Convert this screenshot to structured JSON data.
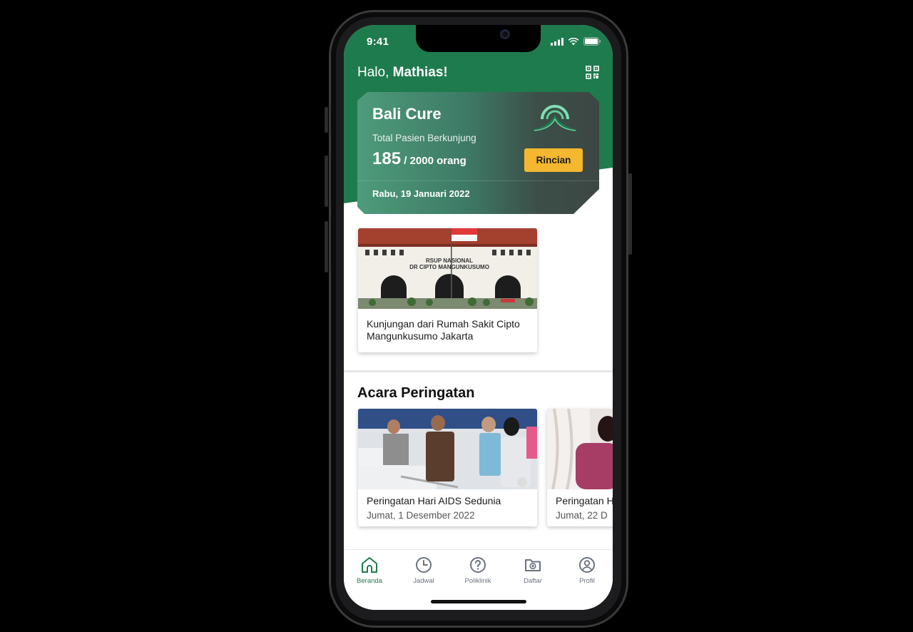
{
  "status_bar": {
    "time": "9:41"
  },
  "header": {
    "greeting_prefix": "Halo, ",
    "user_name": "Mathias!",
    "qr_icon": "qr-code-icon"
  },
  "hero_card": {
    "title": "Bali Cure",
    "subtitle": "Total Pasien Berkunjung",
    "count": "185",
    "count_suffix": " / 2000 orang",
    "button_label": "Rincian",
    "date": "Rabu, 19 Januari 2022",
    "colors": {
      "accent": "#f4b730",
      "brand": "#1e7b4d"
    }
  },
  "news": {
    "image_label_line1": "RSUP NASIONAL",
    "image_label_line2": "DR CIPTO MANGUNKUSUMO",
    "title": "Kunjungan dari Rumah Sakit Cipto Mangunkusumo Jakarta"
  },
  "events": {
    "section_title": "Acara Peringatan",
    "items": [
      {
        "title": "Peringatan Hari AIDS Sedunia",
        "date": "Jumat, 1 Desember 2022"
      },
      {
        "title": "Peringatan H",
        "date": "Jumat, 22 D"
      }
    ]
  },
  "tabbar": {
    "items": [
      {
        "label": "Beranda",
        "icon": "home-icon",
        "active": true
      },
      {
        "label": "Jadwal",
        "icon": "clock-icon",
        "active": false
      },
      {
        "label": "Poliklinik",
        "icon": "help-circle-icon",
        "active": false
      },
      {
        "label": "Daftar",
        "icon": "folder-plus-icon",
        "active": false
      },
      {
        "label": "Profil",
        "icon": "user-circle-icon",
        "active": false
      }
    ]
  }
}
